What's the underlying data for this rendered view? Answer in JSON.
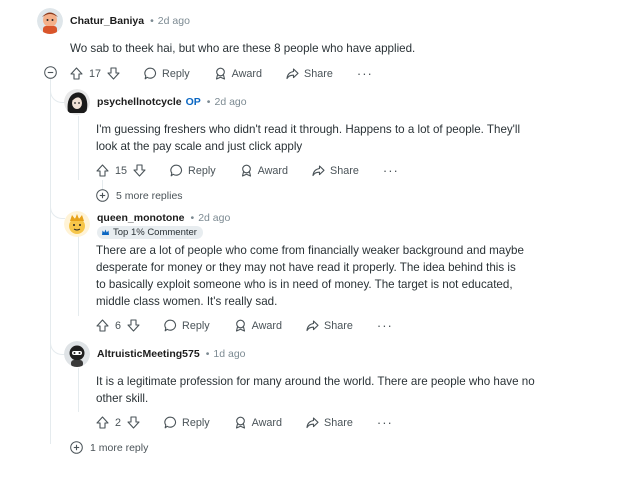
{
  "comments": {
    "chatur": {
      "username": "Chatur_Baniya",
      "time": "2d ago",
      "text": "Wo sab to theek hai, but who are these 8 people who have applied.",
      "votes": "17"
    },
    "psychell": {
      "username": "psychellnotcycle",
      "op_badge": "OP",
      "time": "2d ago",
      "text": "I'm guessing freshers who didn't read it through. Happens to a lot of people. They'll look at the pay scale and just click apply",
      "votes": "15",
      "more_replies": "5 more replies"
    },
    "queen": {
      "username": "queen_monotone",
      "time": "2d ago",
      "flair": "Top 1% Commenter",
      "text": "There are a lot of people who come from financially weaker background and maybe desperate for money or they may not have read it properly. The idea behind this is to basically exploit someone who is in need of money. The target is not educated, middle class women. It's really sad.",
      "votes": "6"
    },
    "altruistic": {
      "username": "AltruisticMeeting575",
      "time": "1d ago",
      "text": "It is a legitimate profession for many around the world. There are people who have no other skill.",
      "votes": "2"
    }
  },
  "actions": {
    "reply": "Reply",
    "award": "Award",
    "share": "Share",
    "more": "···"
  },
  "thread_more_replies": "1 more reply",
  "icons": [
    "upvote-icon",
    "downvote-icon",
    "reply-icon",
    "award-icon",
    "share-icon",
    "collapse-icon",
    "expand-icon",
    "flair-icon"
  ]
}
